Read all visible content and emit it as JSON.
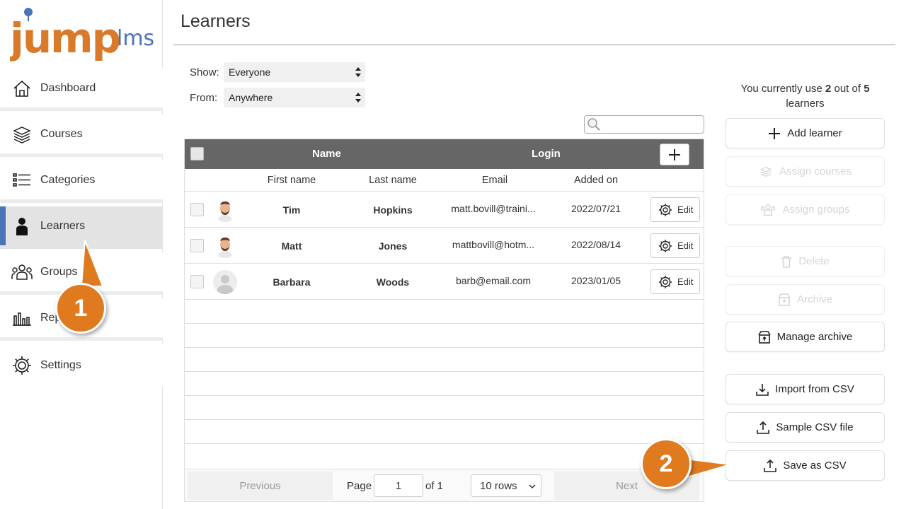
{
  "brand": {
    "logo_main": "jump",
    "logo_sub": "lms",
    "color": "#d97a2a",
    "accent": "#4a74b8"
  },
  "sidebar": {
    "items": [
      {
        "label": "Dashboard",
        "icon": "home-icon",
        "active": false
      },
      {
        "label": "Courses",
        "icon": "books-icon",
        "active": false
      },
      {
        "label": "Categories",
        "icon": "list-icon",
        "active": false
      },
      {
        "label": "Learners",
        "icon": "person-icon",
        "active": true
      },
      {
        "label": "Groups",
        "icon": "group-icon",
        "active": false
      },
      {
        "label": "Rep",
        "icon": "bar-chart-icon",
        "active": false
      },
      {
        "label": "Settings",
        "icon": "gear-icon",
        "active": false
      }
    ]
  },
  "page": {
    "title": "Learners"
  },
  "filters": {
    "show_label": "Show:",
    "show_value": "Everyone",
    "from_label": "From:",
    "from_value": "Anywhere"
  },
  "search": {
    "placeholder": ""
  },
  "table": {
    "header": {
      "name": "Name",
      "login": "Login"
    },
    "columns": [
      "First name",
      "Last name",
      "Email",
      "Added on"
    ],
    "rows": [
      {
        "first": "Tim",
        "last": "Hopkins",
        "email": "matt.bovill@traini...",
        "added": "2022/07/21",
        "edit": "Edit",
        "avatar": "man-avatar"
      },
      {
        "first": "Matt",
        "last": "Jones",
        "email": "mattbovill@hotm...",
        "added": "2022/08/14",
        "edit": "Edit",
        "avatar": "man-avatar"
      },
      {
        "first": "Barbara",
        "last": "Woods",
        "email": "barb@email.com",
        "added": "2023/01/05",
        "edit": "Edit",
        "avatar": "default-avatar"
      }
    ],
    "pager": {
      "previous": "Previous",
      "page_label": "Page",
      "page_value": "1",
      "of_label": "of 1",
      "rows_value": "10 rows",
      "next": "Next"
    }
  },
  "usage": {
    "prefix": "You currently use",
    "used": "2",
    "middle": "out of",
    "total": "5",
    "suffix": "learners"
  },
  "actions": {
    "add_learner": "Add learner",
    "assign_courses": "Assign courses",
    "assign_groups": "Assign groups",
    "delete": "Delete",
    "archive": "Archive",
    "manage_archive": "Manage archive",
    "import_csv": "Import from CSV",
    "sample_csv": "Sample CSV file",
    "save_csv": "Save as CSV"
  },
  "callouts": {
    "one": "1",
    "two": "2",
    "color": "#e07a1f"
  }
}
